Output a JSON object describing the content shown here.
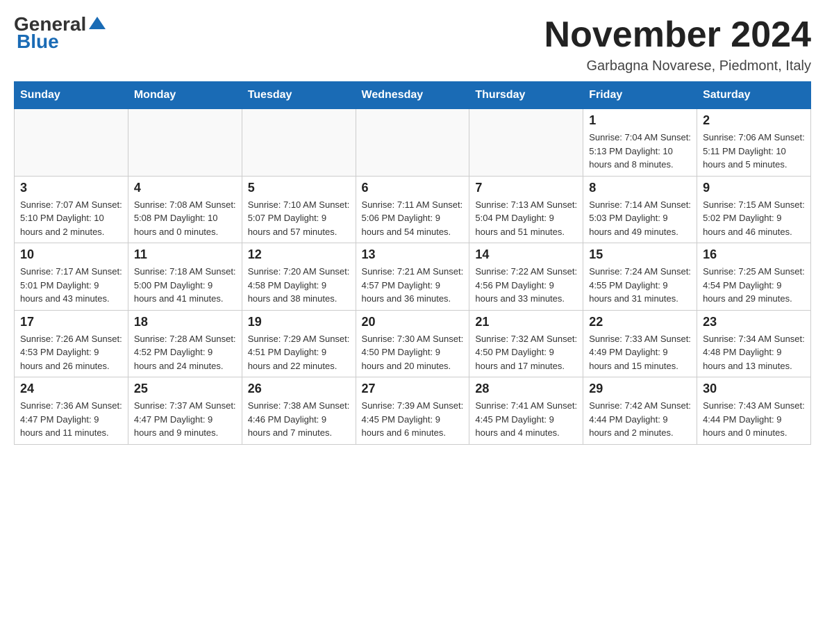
{
  "header": {
    "logo_general": "General",
    "logo_blue": "Blue",
    "month_title": "November 2024",
    "location": "Garbagna Novarese, Piedmont, Italy"
  },
  "days_of_week": [
    "Sunday",
    "Monday",
    "Tuesday",
    "Wednesday",
    "Thursday",
    "Friday",
    "Saturday"
  ],
  "weeks": [
    [
      {
        "day": "",
        "info": ""
      },
      {
        "day": "",
        "info": ""
      },
      {
        "day": "",
        "info": ""
      },
      {
        "day": "",
        "info": ""
      },
      {
        "day": "",
        "info": ""
      },
      {
        "day": "1",
        "info": "Sunrise: 7:04 AM\nSunset: 5:13 PM\nDaylight: 10 hours and 8 minutes."
      },
      {
        "day": "2",
        "info": "Sunrise: 7:06 AM\nSunset: 5:11 PM\nDaylight: 10 hours and 5 minutes."
      }
    ],
    [
      {
        "day": "3",
        "info": "Sunrise: 7:07 AM\nSunset: 5:10 PM\nDaylight: 10 hours and 2 minutes."
      },
      {
        "day": "4",
        "info": "Sunrise: 7:08 AM\nSunset: 5:08 PM\nDaylight: 10 hours and 0 minutes."
      },
      {
        "day": "5",
        "info": "Sunrise: 7:10 AM\nSunset: 5:07 PM\nDaylight: 9 hours and 57 minutes."
      },
      {
        "day": "6",
        "info": "Sunrise: 7:11 AM\nSunset: 5:06 PM\nDaylight: 9 hours and 54 minutes."
      },
      {
        "day": "7",
        "info": "Sunrise: 7:13 AM\nSunset: 5:04 PM\nDaylight: 9 hours and 51 minutes."
      },
      {
        "day": "8",
        "info": "Sunrise: 7:14 AM\nSunset: 5:03 PM\nDaylight: 9 hours and 49 minutes."
      },
      {
        "day": "9",
        "info": "Sunrise: 7:15 AM\nSunset: 5:02 PM\nDaylight: 9 hours and 46 minutes."
      }
    ],
    [
      {
        "day": "10",
        "info": "Sunrise: 7:17 AM\nSunset: 5:01 PM\nDaylight: 9 hours and 43 minutes."
      },
      {
        "day": "11",
        "info": "Sunrise: 7:18 AM\nSunset: 5:00 PM\nDaylight: 9 hours and 41 minutes."
      },
      {
        "day": "12",
        "info": "Sunrise: 7:20 AM\nSunset: 4:58 PM\nDaylight: 9 hours and 38 minutes."
      },
      {
        "day": "13",
        "info": "Sunrise: 7:21 AM\nSunset: 4:57 PM\nDaylight: 9 hours and 36 minutes."
      },
      {
        "day": "14",
        "info": "Sunrise: 7:22 AM\nSunset: 4:56 PM\nDaylight: 9 hours and 33 minutes."
      },
      {
        "day": "15",
        "info": "Sunrise: 7:24 AM\nSunset: 4:55 PM\nDaylight: 9 hours and 31 minutes."
      },
      {
        "day": "16",
        "info": "Sunrise: 7:25 AM\nSunset: 4:54 PM\nDaylight: 9 hours and 29 minutes."
      }
    ],
    [
      {
        "day": "17",
        "info": "Sunrise: 7:26 AM\nSunset: 4:53 PM\nDaylight: 9 hours and 26 minutes."
      },
      {
        "day": "18",
        "info": "Sunrise: 7:28 AM\nSunset: 4:52 PM\nDaylight: 9 hours and 24 minutes."
      },
      {
        "day": "19",
        "info": "Sunrise: 7:29 AM\nSunset: 4:51 PM\nDaylight: 9 hours and 22 minutes."
      },
      {
        "day": "20",
        "info": "Sunrise: 7:30 AM\nSunset: 4:50 PM\nDaylight: 9 hours and 20 minutes."
      },
      {
        "day": "21",
        "info": "Sunrise: 7:32 AM\nSunset: 4:50 PM\nDaylight: 9 hours and 17 minutes."
      },
      {
        "day": "22",
        "info": "Sunrise: 7:33 AM\nSunset: 4:49 PM\nDaylight: 9 hours and 15 minutes."
      },
      {
        "day": "23",
        "info": "Sunrise: 7:34 AM\nSunset: 4:48 PM\nDaylight: 9 hours and 13 minutes."
      }
    ],
    [
      {
        "day": "24",
        "info": "Sunrise: 7:36 AM\nSunset: 4:47 PM\nDaylight: 9 hours and 11 minutes."
      },
      {
        "day": "25",
        "info": "Sunrise: 7:37 AM\nSunset: 4:47 PM\nDaylight: 9 hours and 9 minutes."
      },
      {
        "day": "26",
        "info": "Sunrise: 7:38 AM\nSunset: 4:46 PM\nDaylight: 9 hours and 7 minutes."
      },
      {
        "day": "27",
        "info": "Sunrise: 7:39 AM\nSunset: 4:45 PM\nDaylight: 9 hours and 6 minutes."
      },
      {
        "day": "28",
        "info": "Sunrise: 7:41 AM\nSunset: 4:45 PM\nDaylight: 9 hours and 4 minutes."
      },
      {
        "day": "29",
        "info": "Sunrise: 7:42 AM\nSunset: 4:44 PM\nDaylight: 9 hours and 2 minutes."
      },
      {
        "day": "30",
        "info": "Sunrise: 7:43 AM\nSunset: 4:44 PM\nDaylight: 9 hours and 0 minutes."
      }
    ]
  ]
}
